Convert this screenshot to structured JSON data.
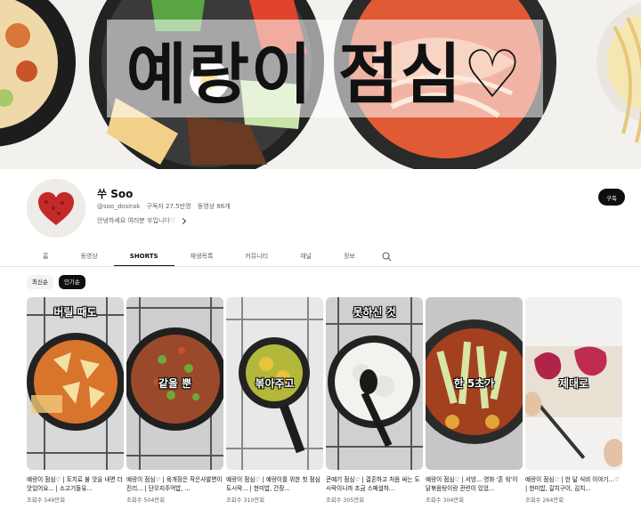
{
  "banner": {
    "title": "예랑이 점심♡"
  },
  "channel": {
    "name": "쑤 Soo",
    "handle": "@soo_dosirak",
    "subscribers": "구독자 27.5만명",
    "video_count": "동영상 86개",
    "description": "안녕하세요 여러분 쑤입니다♡",
    "subscribe_label": "구독"
  },
  "tabs": [
    "홈",
    "동영상",
    "SHORTS",
    "재생목록",
    "커뮤니티",
    "채널",
    "정보"
  ],
  "active_tab": "SHORTS",
  "filters": [
    "최신순",
    "인기순"
  ],
  "active_filter": "인기순",
  "shorts": [
    {
      "overlay": "버릴 때도",
      "title": "예랑이 점심♡ | 토치로 불 맛을 내면 더 맛있어요... | 소고기돌유...",
      "views": "조회수 549만회"
    },
    {
      "overlay": "같을 뿐",
      "title": "예랑이 점심♡ | 육개장은 작은사발면이 진리... | 단무지주먹밥, ...",
      "views": "조회수 504만회"
    },
    {
      "overlay": "볶아주고",
      "title": "예랑이 점심♡ | 예랑이를 위한 첫 점심 도시락... | 현미밥, 간장...",
      "views": "조회수 310만회"
    },
    {
      "overlay": "못하신 것",
      "title": "큰예기 점심♡ | 결혼하고 처음 싸는 도시락이니까 조금 스페셜하...",
      "views": "조회수 305만회"
    },
    {
      "overlay": "한 5초가",
      "title": "예랑이 점심♡ | 서방... 영화 '존 윅'이 닭볶음탕이랑 관련이 있었...",
      "views": "조회수 304만회"
    },
    {
      "overlay": "제대로",
      "title": "예랑이 점심♡ | 한 달 식비 이야기...♡ | 현미밥, 갈치구이, 김치...",
      "views": "조회수 264만회"
    }
  ],
  "colors": {
    "accent": "#0f0f0f",
    "muted": "#606060",
    "chip_bg": "#f2f2f2"
  }
}
